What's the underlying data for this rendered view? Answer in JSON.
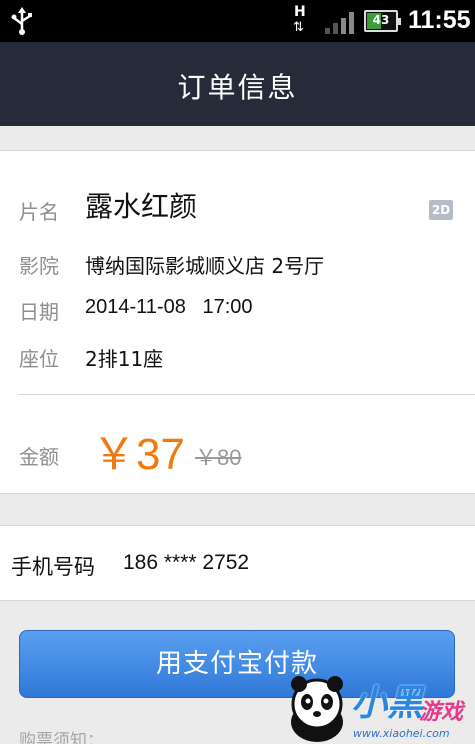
{
  "status_bar": {
    "network_type": "H",
    "battery_percent": "43",
    "time": "11:55",
    "icons": [
      "usb-icon",
      "network-activity-icon",
      "signal-icon",
      "battery-icon"
    ]
  },
  "header": {
    "title": "订单信息"
  },
  "order": {
    "film_label": "片名",
    "film_value": "露水红颜",
    "format_badge": "2D",
    "cinema_label": "影院",
    "cinema_value": "博纳国际影城顺义店 2号厅",
    "date_label": "日期",
    "date_value": "2014-11-08   17:00",
    "seat_label": "座位",
    "seat_value": "2排11座",
    "amount_label": "金额",
    "price": "￥37",
    "original_price": "￥80"
  },
  "phone": {
    "label": "手机号码",
    "value": "186 **** 2752"
  },
  "pay_button": {
    "label": "用支付宝付款"
  },
  "notice": {
    "label": "购票须知："
  },
  "watermark": {
    "brand": "小黑",
    "brand_sub": "游戏",
    "url": "www.xiaohei.com"
  },
  "colors": {
    "header_bg": "#252b39",
    "price": "#f07a10",
    "pay_button": "#3a84e2"
  }
}
